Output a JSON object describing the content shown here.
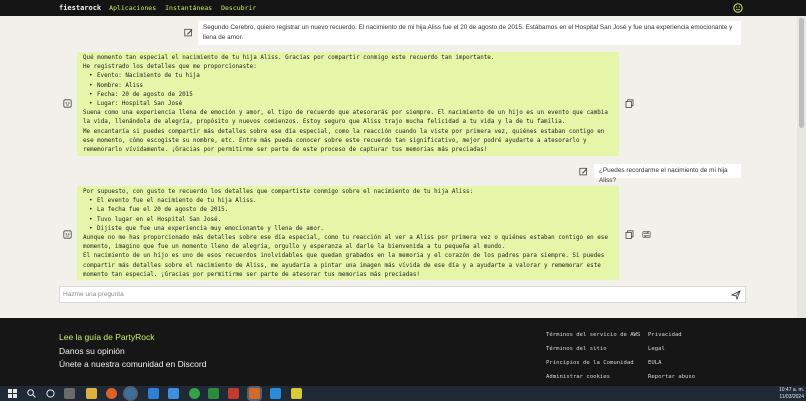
{
  "nav": {
    "brand": "fiestarock",
    "links": [
      "Aplicaciones",
      "Instantáneas",
      "Descubrir"
    ]
  },
  "chat": {
    "user1": "Segundo Cerebro, quiero registrar un nuevo recuerdo. El nacimiento de mi hija Aliss fue el 20 de agosto de 2015. Estábamos en el Hospital San José y fue una experiencia emocionante y llena de amor.",
    "ai1": {
      "intro": "Qué momento tan especial el nacimiento de tu hija Aliss. Gracias por compartir conmigo este recuerdo tan importante.",
      "lead": "He registrado los detalles que me proporcionaste:",
      "bullets": [
        "Evento: Nacimiento de tu hija",
        "Nombre: Aliss",
        "Fecha: 20 de agosto de 2015",
        "Lugar: Hospital San José"
      ],
      "p1": "Suena como una experiencia llena de emoción y amor, el tipo de recuerdo que atesorarás por siempre. El nacimiento de un hijo es un evento que cambia la vida, llenándola de alegría, propósito y nuevos comienzos. Estoy seguro que Aliss trajo mucha felicidad a tu vida y la de tu familia.",
      "p2": "Me encantaría si puedes compartir más detalles sobre ese día especial, como la reacción cuando la viste por primera vez, quiénes estaban contigo en ese momento, cómo escogiste su nombre, etc. Entre más pueda conocer sobre este recuerdo tan significativo, mejor podré ayudarte a atesorarlo y rememorarlo vívidamente. ¡Gracias por permitirme ser parte de este proceso de capturar tus memorias más preciadas!"
    },
    "user2": "¿Puedes recordarme el nacimiento de mi hija Aliss?",
    "ai2": {
      "intro": "Por supuesto, con gusto te recuerdo los detalles que compartiste conmigo sobre el nacimiento de tu hija Aliss:",
      "bullets": [
        "El evento fue el nacimiento de tu hija Aliss.",
        "La fecha fue el 20 de agosto de 2015.",
        "Tuvo lugar en el Hospital San José.",
        "Dijiste que fue una experiencia muy emocionante y llena de amor."
      ],
      "p1": "Aunque no me has proporcionado más detalles sobre ese día especial, como tu reacción al ver a Aliss por primera vez o quiénes estaban contigo en ese momento, imagino que fue un momento lleno de alegría, orgullo y esperanza al darle la bienvenida a tu pequeña al mundo.",
      "p2": "El nacimiento de un hijo es uno de esos recuerdos inolvidables que quedan grabados en la memoria y el corazón de los padres para siempre. Si puedes compartir más detalles sobre el nacimiento de Aliss, me ayudaría a pintar una imagen más vívida de ese día y a ayudarte a valorar y rememorar este momento tan especial. ¡Gracias por permitirme ser parte de atesorar tus memorias más preciadas!"
    },
    "input_placeholder": "Hazme una pregunta"
  },
  "footer": {
    "left": [
      "Lee la guía de PartyRock",
      "Danos su opinión",
      "Únete a nuestra comunidad en Discord"
    ],
    "col1": [
      "Términos del servicio de AWS",
      "Términos del sitio",
      "Principios de la Comunidad",
      "Administrar cookies"
    ],
    "col2": [
      "Privacidad",
      "Legal",
      "EULA",
      "Reportar abuso"
    ]
  },
  "taskbar": {
    "time": "10:47 a. m.",
    "date": "11/03/2024"
  },
  "colors": {
    "accent": "#c9f06a",
    "ai_bubble": "#e5f6a9",
    "page_bg": "#f1f0ea"
  }
}
